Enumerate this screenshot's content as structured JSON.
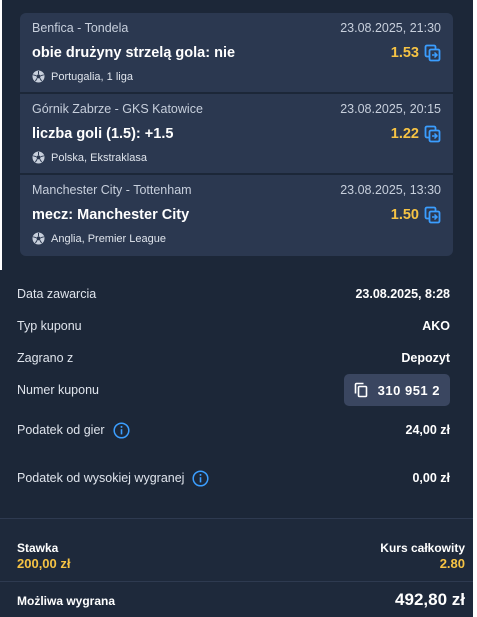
{
  "bets": [
    {
      "match": "Benfica - Tondela",
      "datetime": "23.08.2025, 21:30",
      "pick": "obie drużyny strzelą gola: nie",
      "odds": "1.53",
      "league": "Portugalia, 1 liga"
    },
    {
      "match": "Górnik Zabrze - GKS Katowice",
      "datetime": "23.08.2025, 20:15",
      "pick": "liczba goli (1.5): +1.5",
      "odds": "1.22",
      "league": "Polska, Ekstraklasa"
    },
    {
      "match": "Manchester City - Tottenham",
      "datetime": "23.08.2025, 13:30",
      "pick": "mecz: Manchester City",
      "odds": "1.50",
      "league": "Anglia, Premier League"
    }
  ],
  "details": {
    "date_label": "Data zawarcia",
    "date_value": "23.08.2025, 8:28",
    "type_label": "Typ kuponu",
    "type_value": "AKO",
    "source_label": "Zagrano z",
    "source_value": "Depozyt",
    "coupon_label": "Numer kuponu",
    "coupon_value": "310 951 2",
    "tax_label": "Podatek od gier",
    "tax_value": "24,00 zł",
    "high_tax_label": "Podatek od wysokiej wygranej",
    "high_tax_value": "0,00 zł"
  },
  "summary": {
    "stake_label": "Stawka",
    "stake_value": "200,00 zł",
    "total_odds_label": "Kurs całkowity",
    "total_odds_value": "2.80",
    "win_label": "Możliwa wygrana",
    "win_value": "492,80 zł"
  },
  "colors": {
    "accent": "#f6c344",
    "copy_icon": "#3b9eff",
    "panel": "#1c2738",
    "card": "#2b3850"
  },
  "icons": {
    "copy": "copy-icon",
    "ball": "football-icon",
    "info": "info-icon"
  }
}
